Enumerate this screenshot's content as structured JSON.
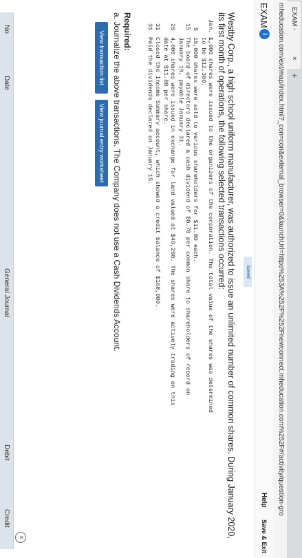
{
  "browser": {
    "tab_title": "EXAM -",
    "tab_close": "×",
    "new_tab": "+",
    "url": "mheducation.com/ext/map/index.html?_con=con&external_browser=0&launchUrl=https%253A%252F%252Fnewconnect.mheducation.com%252F#/activity/question-gro"
  },
  "header": {
    "title": "EXAM",
    "info_glyph": "i",
    "help": "Help",
    "save_exit": "Save & Exit"
  },
  "status": {
    "saved": "Saved"
  },
  "question": {
    "intro": "Westby Corp., a high school uniform manufacturer, was authorized to issue an unlimited number of common shares. During January 2020, its first month of operations, the following selected transactions occurred:",
    "transactions": [
      {
        "date": "Jan.  1",
        "lines": [
          "1,000 shares were issued to the organizers of the corporation. The total value of the shares was determined",
          "to be $12,300."
        ]
      },
      {
        "date": "5",
        "lines": [
          "15,000 shares were sold to various shareholders for $11.80 each."
        ]
      },
      {
        "date": "15",
        "lines": [
          "The board of directors declared a cash dividend of $0.78 per common share to shareholders of record on",
          "January 19, payable January 31."
        ]
      },
      {
        "date": "20",
        "lines": [
          "4,000 shares were issued in exchange for land valued at $49,200. The shares were actively trading on this",
          "date at $11.80 per share."
        ]
      },
      {
        "date": "31",
        "lines": [
          "Closed the Income Summary account, which showed a credit balance of $168,000."
        ]
      },
      {
        "date": "31",
        "lines": [
          "Paid the dividends declared on January 15."
        ]
      }
    ],
    "required_label": "Required:",
    "required_a": "a. Journalize the above transactions. The Company does not use a Cash Dividends Account."
  },
  "buttons": {
    "view_transaction_list": "View transaction list",
    "view_journal_worksheet": "View journal entry worksheet"
  },
  "journal": {
    "close_glyph": "×",
    "columns": {
      "no": "No",
      "date": "Date",
      "general_journal": "General Journal",
      "debit": "Debit",
      "credit": "Credit"
    }
  }
}
